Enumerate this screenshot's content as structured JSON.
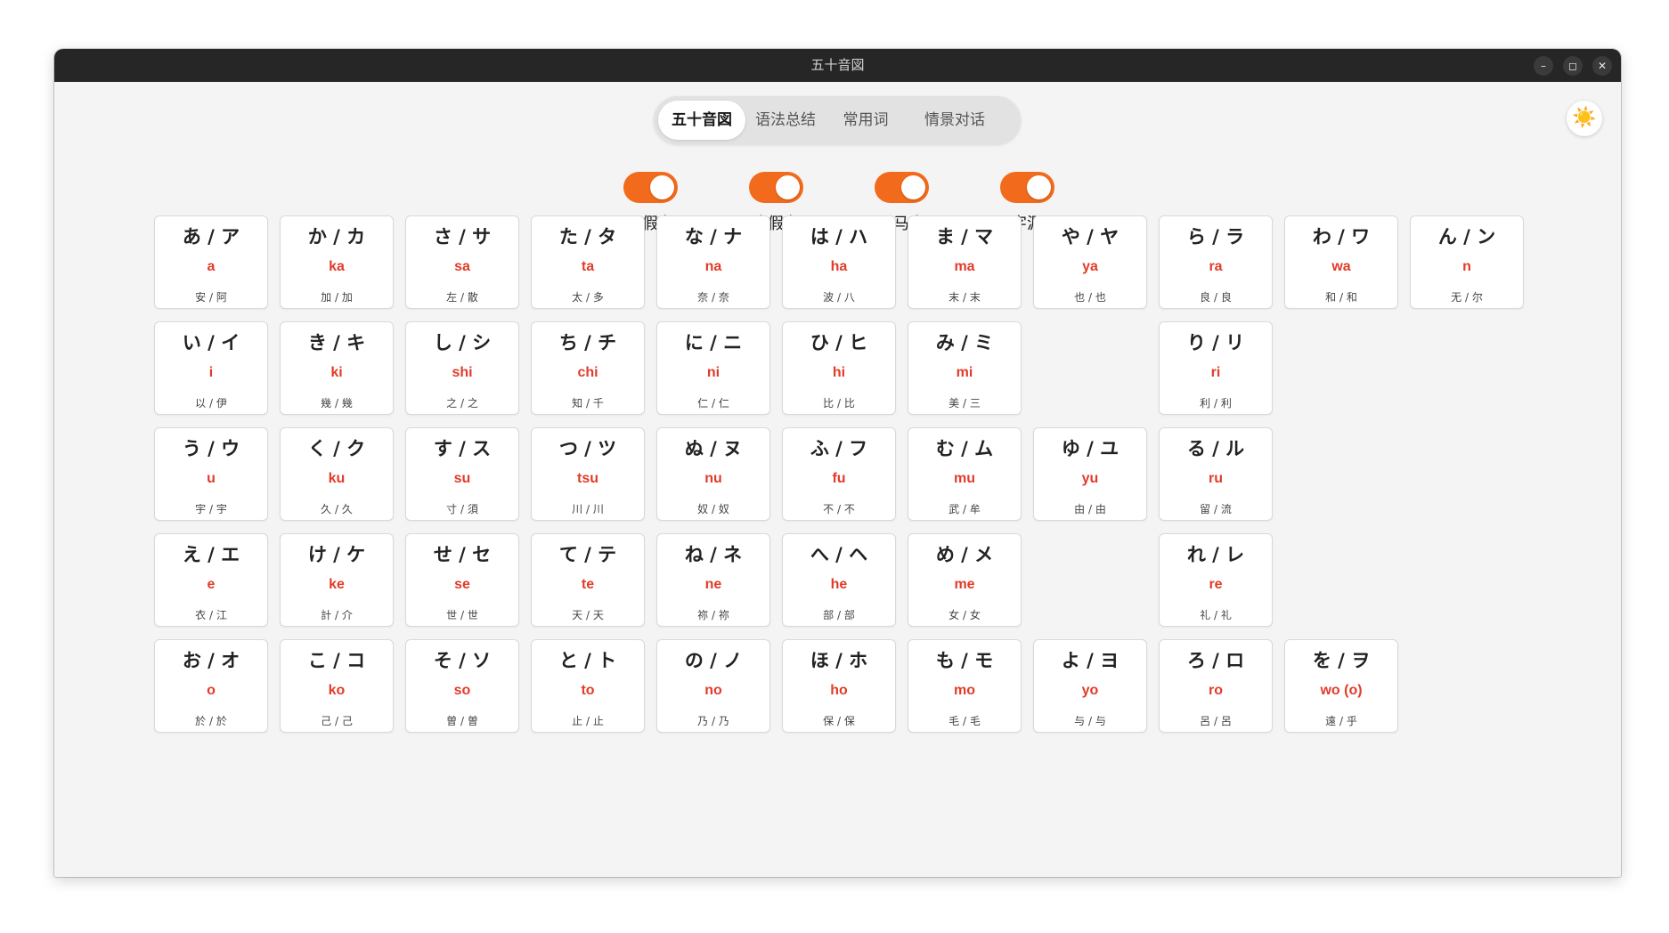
{
  "window": {
    "title": "五十音図"
  },
  "window_controls": {
    "minimize": "–",
    "maximize": "◻",
    "close": "✕"
  },
  "tabs": [
    {
      "label": "五十音図",
      "active": true
    },
    {
      "label": "语法总结",
      "active": false
    },
    {
      "label": "常用词",
      "active": false
    },
    {
      "label": "情景对话",
      "active": false
    }
  ],
  "theme_toggle": {
    "icon": "sun-icon",
    "glyph": "☀️"
  },
  "toggles": [
    {
      "label": "平假名",
      "on": true
    },
    {
      "label": "片假名",
      "on": true
    },
    {
      "label": "罗马音",
      "on": true
    },
    {
      "label": "字源",
      "on": true
    }
  ],
  "colors": {
    "accent": "#f26a1b",
    "romaji": "#e23b2a"
  },
  "kana_grid": [
    {
      "col": 0,
      "row": 0,
      "kana": "あ / ア",
      "romaji": "a",
      "origin": "安 / 阿"
    },
    {
      "col": 1,
      "row": 0,
      "kana": "か / カ",
      "romaji": "ka",
      "origin": "加 / 加"
    },
    {
      "col": 2,
      "row": 0,
      "kana": "さ / サ",
      "romaji": "sa",
      "origin": "左 / 散"
    },
    {
      "col": 3,
      "row": 0,
      "kana": "た / タ",
      "romaji": "ta",
      "origin": "太 / 多"
    },
    {
      "col": 4,
      "row": 0,
      "kana": "な / ナ",
      "romaji": "na",
      "origin": "奈 / 奈"
    },
    {
      "col": 5,
      "row": 0,
      "kana": "は / ハ",
      "romaji": "ha",
      "origin": "波 / 八"
    },
    {
      "col": 6,
      "row": 0,
      "kana": "ま / マ",
      "romaji": "ma",
      "origin": "末 / 末"
    },
    {
      "col": 7,
      "row": 0,
      "kana": "や / ヤ",
      "romaji": "ya",
      "origin": "也 / 也"
    },
    {
      "col": 8,
      "row": 0,
      "kana": "ら / ラ",
      "romaji": "ra",
      "origin": "良 / 良"
    },
    {
      "col": 9,
      "row": 0,
      "kana": "わ / ワ",
      "romaji": "wa",
      "origin": "和 / 和"
    },
    {
      "col": 10,
      "row": 0,
      "kana": "ん / ン",
      "romaji": "n",
      "origin": "无 / 尔"
    },
    {
      "col": 0,
      "row": 1,
      "kana": "い / イ",
      "romaji": "i",
      "origin": "以 / 伊"
    },
    {
      "col": 1,
      "row": 1,
      "kana": "き / キ",
      "romaji": "ki",
      "origin": "幾 / 幾"
    },
    {
      "col": 2,
      "row": 1,
      "kana": "し / シ",
      "romaji": "shi",
      "origin": "之 / 之"
    },
    {
      "col": 3,
      "row": 1,
      "kana": "ち / チ",
      "romaji": "chi",
      "origin": "知 / 千"
    },
    {
      "col": 4,
      "row": 1,
      "kana": "に / ニ",
      "romaji": "ni",
      "origin": "仁 / 仁"
    },
    {
      "col": 5,
      "row": 1,
      "kana": "ひ / ヒ",
      "romaji": "hi",
      "origin": "比 / 比"
    },
    {
      "col": 6,
      "row": 1,
      "kana": "み / ミ",
      "romaji": "mi",
      "origin": "美 / 三"
    },
    {
      "col": 8,
      "row": 1,
      "kana": "り / リ",
      "romaji": "ri",
      "origin": "利 / 利"
    },
    {
      "col": 0,
      "row": 2,
      "kana": "う / ウ",
      "romaji": "u",
      "origin": "宇 / 宇"
    },
    {
      "col": 1,
      "row": 2,
      "kana": "く / ク",
      "romaji": "ku",
      "origin": "久 / 久"
    },
    {
      "col": 2,
      "row": 2,
      "kana": "す / ス",
      "romaji": "su",
      "origin": "寸 / 須"
    },
    {
      "col": 3,
      "row": 2,
      "kana": "つ / ツ",
      "romaji": "tsu",
      "origin": "川 / 川"
    },
    {
      "col": 4,
      "row": 2,
      "kana": "ぬ / ヌ",
      "romaji": "nu",
      "origin": "奴 / 奴"
    },
    {
      "col": 5,
      "row": 2,
      "kana": "ふ / フ",
      "romaji": "fu",
      "origin": "不 / 不"
    },
    {
      "col": 6,
      "row": 2,
      "kana": "む / ム",
      "romaji": "mu",
      "origin": "武 / 牟"
    },
    {
      "col": 7,
      "row": 2,
      "kana": "ゆ / ユ",
      "romaji": "yu",
      "origin": "由 / 由"
    },
    {
      "col": 8,
      "row": 2,
      "kana": "る / ル",
      "romaji": "ru",
      "origin": "留 / 流"
    },
    {
      "col": 0,
      "row": 3,
      "kana": "え / エ",
      "romaji": "e",
      "origin": "衣 / 江"
    },
    {
      "col": 1,
      "row": 3,
      "kana": "け / ケ",
      "romaji": "ke",
      "origin": "計 / 介"
    },
    {
      "col": 2,
      "row": 3,
      "kana": "せ / セ",
      "romaji": "se",
      "origin": "世 / 世"
    },
    {
      "col": 3,
      "row": 3,
      "kana": "て / テ",
      "romaji": "te",
      "origin": "天 / 天"
    },
    {
      "col": 4,
      "row": 3,
      "kana": "ね / ネ",
      "romaji": "ne",
      "origin": "祢 / 祢"
    },
    {
      "col": 5,
      "row": 3,
      "kana": "へ / ヘ",
      "romaji": "he",
      "origin": "部 / 部"
    },
    {
      "col": 6,
      "row": 3,
      "kana": "め / メ",
      "romaji": "me",
      "origin": "女 / 女"
    },
    {
      "col": 8,
      "row": 3,
      "kana": "れ / レ",
      "romaji": "re",
      "origin": "礼 / 礼"
    },
    {
      "col": 0,
      "row": 4,
      "kana": "お / オ",
      "romaji": "o",
      "origin": "於 / 於"
    },
    {
      "col": 1,
      "row": 4,
      "kana": "こ / コ",
      "romaji": "ko",
      "origin": "己 / 己"
    },
    {
      "col": 2,
      "row": 4,
      "kana": "そ / ソ",
      "romaji": "so",
      "origin": "曽 / 曽"
    },
    {
      "col": 3,
      "row": 4,
      "kana": "と / ト",
      "romaji": "to",
      "origin": "止 / 止"
    },
    {
      "col": 4,
      "row": 4,
      "kana": "の / ノ",
      "romaji": "no",
      "origin": "乃 / 乃"
    },
    {
      "col": 5,
      "row": 4,
      "kana": "ほ / ホ",
      "romaji": "ho",
      "origin": "保 / 保"
    },
    {
      "col": 6,
      "row": 4,
      "kana": "も / モ",
      "romaji": "mo",
      "origin": "毛 / 毛"
    },
    {
      "col": 7,
      "row": 4,
      "kana": "よ / ヨ",
      "romaji": "yo",
      "origin": "与 / 与"
    },
    {
      "col": 8,
      "row": 4,
      "kana": "ろ / ロ",
      "romaji": "ro",
      "origin": "呂 / 呂"
    },
    {
      "col": 9,
      "row": 4,
      "kana": "を / ヲ",
      "romaji": "wo (o)",
      "origin": "遠 / 乎"
    }
  ]
}
